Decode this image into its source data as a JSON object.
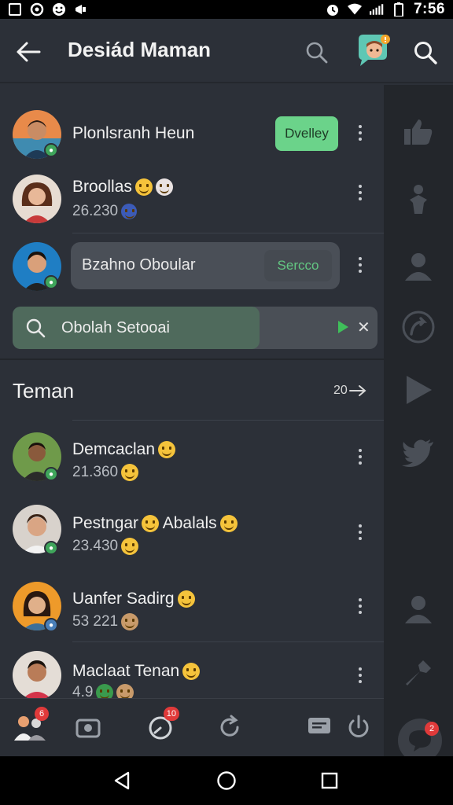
{
  "status_bar": {
    "time": "7:56"
  },
  "header": {
    "title": "Desiád Maman"
  },
  "top_list": [
    {
      "name": "Plonlsranh Heun",
      "action": "Dvelley"
    },
    {
      "name": "Broollas",
      "sub": "26.230"
    },
    {
      "name": "Bzahno Oboular",
      "action": "Sercco"
    }
  ],
  "search": {
    "text": "Obolah Setooai",
    "clear": "✕"
  },
  "section": {
    "title": "Teman",
    "more": "20"
  },
  "friends": [
    {
      "name": "Demcaclan",
      "sub": "21.360"
    },
    {
      "name": "Pestngar",
      "name2": "Abalals",
      "sub": "23.430"
    },
    {
      "name": "Uanfer Sadirg",
      "sub": "53 221"
    },
    {
      "name": "Maclaat Tenan",
      "sub": "4.9"
    }
  ],
  "bottom_nav": {
    "badge_1": "6",
    "badge_2": "10",
    "badge_chat": "2"
  },
  "colors": {
    "background": "#2c3038",
    "rail": "#23262b",
    "accent_green": "#6bd38a",
    "badge_red": "#e03a3a"
  }
}
